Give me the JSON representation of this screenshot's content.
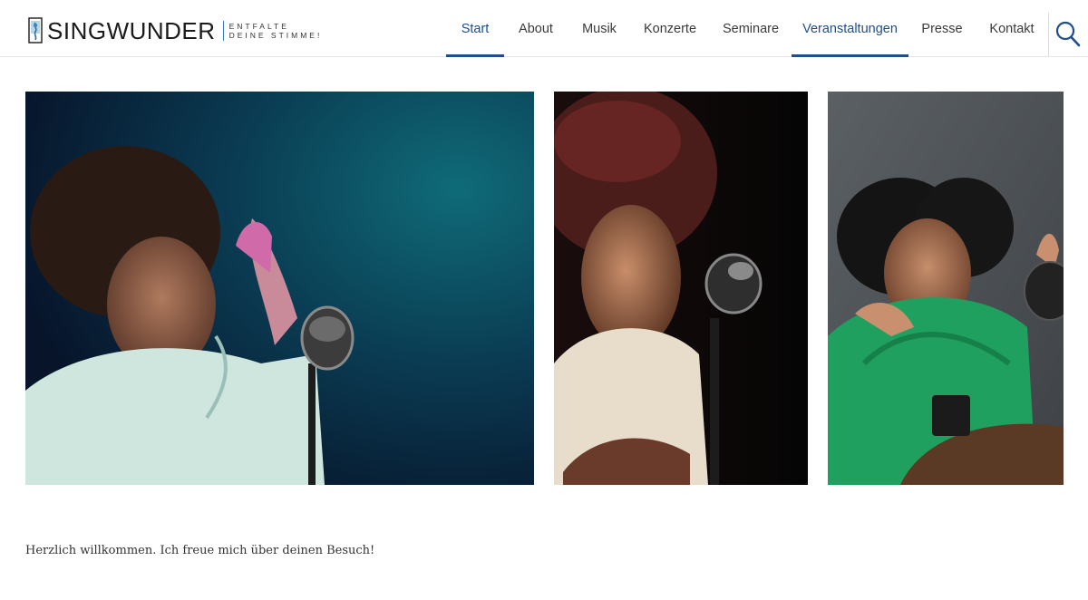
{
  "brand": {
    "name": "SINGWUNDER",
    "tagline_line1": "ENTFALTE",
    "tagline_line2": "DEINE STIMME!"
  },
  "nav": {
    "items": [
      {
        "label": "Start",
        "active": true
      },
      {
        "label": "About",
        "active": false
      },
      {
        "label": "Musik",
        "active": false
      },
      {
        "label": "Konzerte",
        "active": false
      },
      {
        "label": "Seminare",
        "active": false
      },
      {
        "label": "Veranstaltungen",
        "active": true
      },
      {
        "label": "Presse",
        "active": false
      },
      {
        "label": "Kontakt",
        "active": false
      }
    ],
    "search_icon": "search-icon"
  },
  "gallery": {
    "images": [
      {
        "name": "singer-with-microphone-teal-light"
      },
      {
        "name": "singer-eyes-closed-dark-background"
      },
      {
        "name": "woman-green-blouse-podcast-studio"
      }
    ]
  },
  "main": {
    "welcome_text": "Herzlich willkommen. Ich freue mich über deinen Besuch!"
  },
  "colors": {
    "accent": "#1f4e8a",
    "text": "#333333"
  }
}
